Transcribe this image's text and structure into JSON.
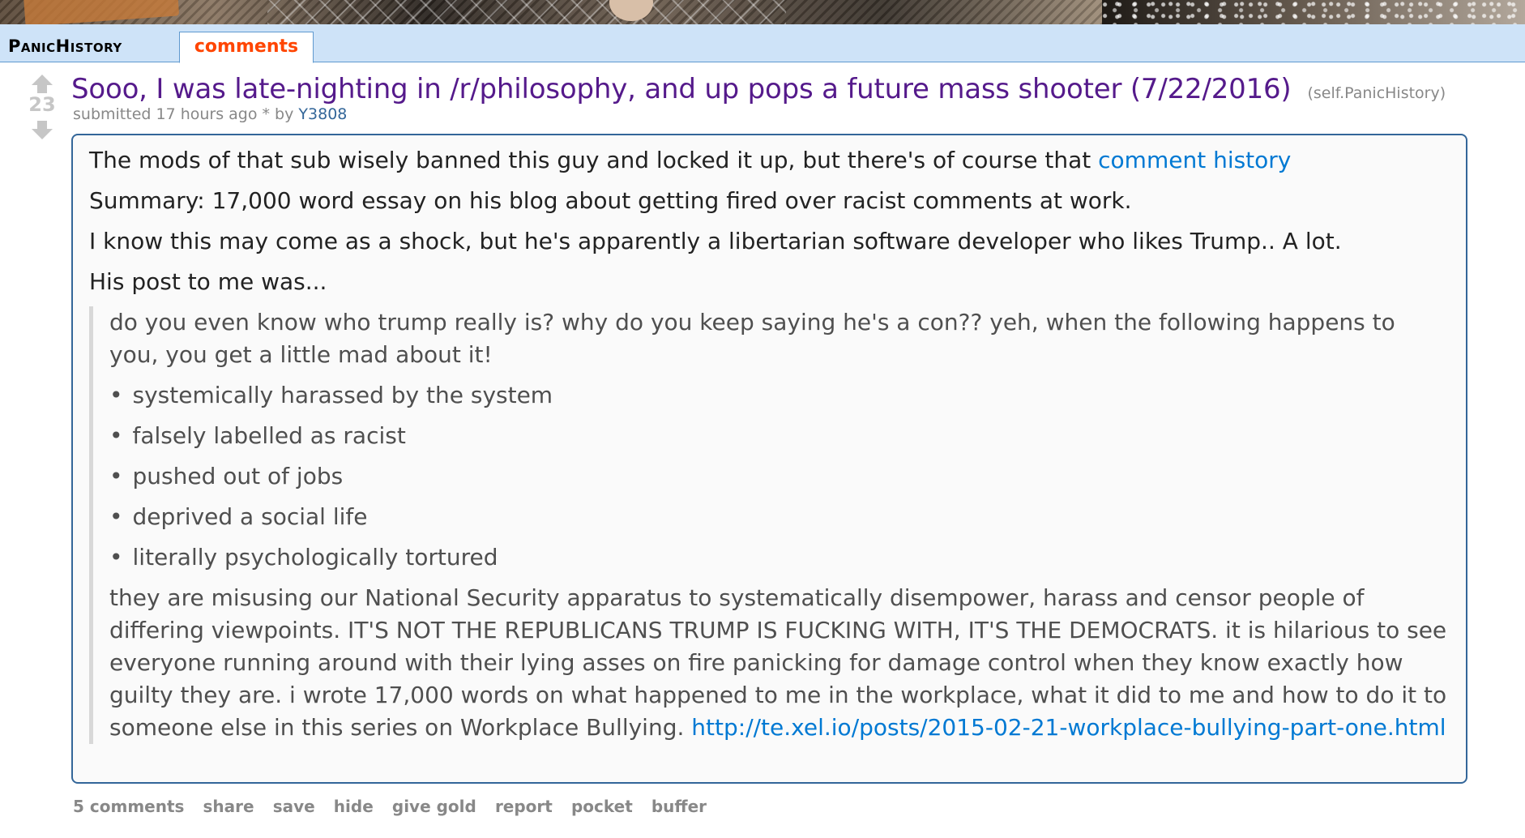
{
  "header": {
    "subreddit": "PanicHistory",
    "active_tab": "comments"
  },
  "post": {
    "score": "23",
    "title": "Sooo, I was late-nighting in /r/philosophy, and up pops a future mass shooter (7/22/2016)",
    "domain": "(self.PanicHistory)",
    "tagline_prefix": "submitted 17 hours ago * by ",
    "author": "Y3808"
  },
  "selftext": {
    "p1_text": "The mods of that sub wisely banned this guy and locked it up, but there's of course that ",
    "p1_link": "comment history",
    "p2": "Summary: 17,000 word essay on his blog about getting fired over racist comments at work.",
    "p3": "I know this may come as a shock, but he's apparently a libertarian software developer who likes Trump.. A lot.",
    "p4": "His post to me was...",
    "quote": {
      "intro": "do you even know who trump really is? why do you keep saying he's a con?? yeh, when the following happens to you, you get a little mad about it!",
      "items": [
        "systemically harassed by the system",
        "falsely labelled as racist",
        "pushed out of jobs",
        "deprived a social life",
        "literally psychologically tortured"
      ],
      "outro": "they are misusing our National Security apparatus to systematically disempower, harass and censor people of differing viewpoints. IT'S NOT THE REPUBLICANS TRUMP IS FUCKING WITH, IT'S THE DEMOCRATS. it is hilarious to see everyone running around with their lying asses on fire panicking for damage control when they know exactly how guilty they are. i wrote 17,000 words on what happened to me in the workplace, what it did to me and how to do it to someone else in this series on Workplace Bullying. ",
      "link": "http://te.xel.io/posts/2015-02-21-workplace-bullying-part-one.html"
    }
  },
  "buttons": [
    "5 comments",
    "share",
    "save",
    "hide",
    "give gold",
    "report",
    "pocket",
    "buffer"
  ],
  "colors": {
    "header_bg": "#cee3f8",
    "tab_accent": "#ff4500",
    "title_visited": "#551a8b",
    "link": "#0079d3",
    "box_border": "#336699"
  }
}
